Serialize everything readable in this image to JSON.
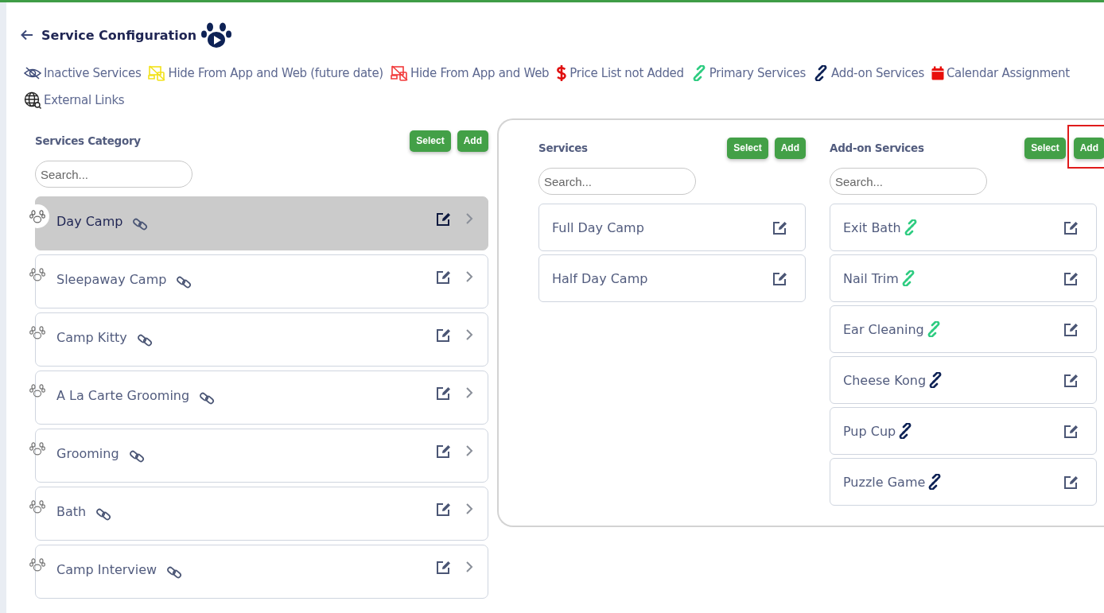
{
  "header": {
    "title": "Service Configuration"
  },
  "legend": [
    {
      "kind": "inactive",
      "label": "Inactive Services"
    },
    {
      "kind": "hide-future",
      "label": "Hide From App and Web (future date)"
    },
    {
      "kind": "hide",
      "label": "Hide From App and Web"
    },
    {
      "kind": "price",
      "label": "Price List not Added"
    },
    {
      "kind": "primary",
      "label": "Primary Services"
    },
    {
      "kind": "addon",
      "label": "Add-on Services"
    },
    {
      "kind": "calendar",
      "label": "Calendar Assignment"
    },
    {
      "kind": "external",
      "label": "External Links"
    }
  ],
  "categories": {
    "title": "Services Category",
    "buttons": [
      {
        "label": "Select",
        "highlighted": false
      },
      {
        "label": "Add",
        "highlighted": false
      }
    ],
    "search": {
      "placeholder": "Search..."
    },
    "items": [
      {
        "name": "Day Camp",
        "selected": true
      },
      {
        "name": "Sleepaway Camp",
        "selected": false
      },
      {
        "name": "Camp Kitty",
        "selected": false
      },
      {
        "name": "A La Carte Grooming",
        "selected": false
      },
      {
        "name": "Grooming",
        "selected": false
      },
      {
        "name": "Bath",
        "selected": false
      },
      {
        "name": "Camp Interview",
        "selected": false
      }
    ]
  },
  "services": {
    "title": "Services",
    "buttons": [
      {
        "label": "Select",
        "highlighted": false
      },
      {
        "label": "Add",
        "highlighted": false
      }
    ],
    "search": {
      "placeholder": "Search..."
    },
    "items": [
      {
        "name": "Full Day Camp"
      },
      {
        "name": "Half Day Camp"
      }
    ]
  },
  "addon_services": {
    "title": "Add-on Services",
    "buttons": [
      {
        "label": "Select",
        "highlighted": false
      },
      {
        "label": "Add",
        "highlighted": true
      }
    ],
    "search": {
      "placeholder": "Search..."
    },
    "items": [
      {
        "name": "Exit Bath",
        "kind": "primary"
      },
      {
        "name": "Nail Trim",
        "kind": "primary"
      },
      {
        "name": "Ear Cleaning",
        "kind": "primary"
      },
      {
        "name": "Cheese Kong",
        "kind": "addon"
      },
      {
        "name": "Pup Cup",
        "kind": "addon"
      },
      {
        "name": "Puzzle Game",
        "kind": "addon"
      }
    ]
  }
}
